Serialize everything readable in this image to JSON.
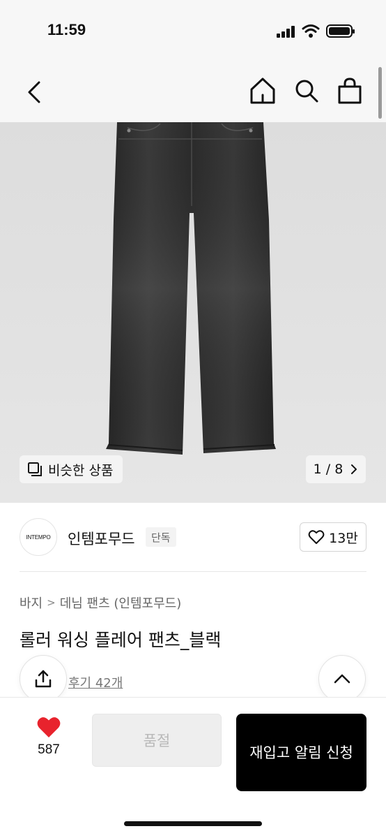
{
  "status_bar": {
    "time": "11:59"
  },
  "icons": {
    "back": "chevron-left-icon",
    "home": "home-icon",
    "search": "search-icon",
    "bag": "shopping-bag-icon",
    "similar": "stacked-squares-icon",
    "counter_next": "chevron-right-icon",
    "like": "heart-outline-icon",
    "share": "share-icon",
    "top": "chevron-up-icon",
    "wish": "heart-filled-icon"
  },
  "gallery": {
    "similar_label": "비슷한 상품",
    "counter": "1 / 8"
  },
  "brand": {
    "logo_text": "INTEMPO",
    "name": "인템포무드",
    "badge": "단독",
    "like_count": "13만"
  },
  "product": {
    "breadcrumb": [
      "바지",
      "데님 팬츠 (인템포무드)"
    ],
    "title": "롤러 워싱 플레어 팬츠_블랙",
    "reviews": "후기 42개"
  },
  "bottom_bar": {
    "wish_count": "587",
    "soldout_label": "품절",
    "restock_label": "재입고 알림 신청"
  },
  "colors": {
    "accent_heart": "#e8232d",
    "primary_button": "#000000",
    "disabled_button": "#eeeeee"
  }
}
